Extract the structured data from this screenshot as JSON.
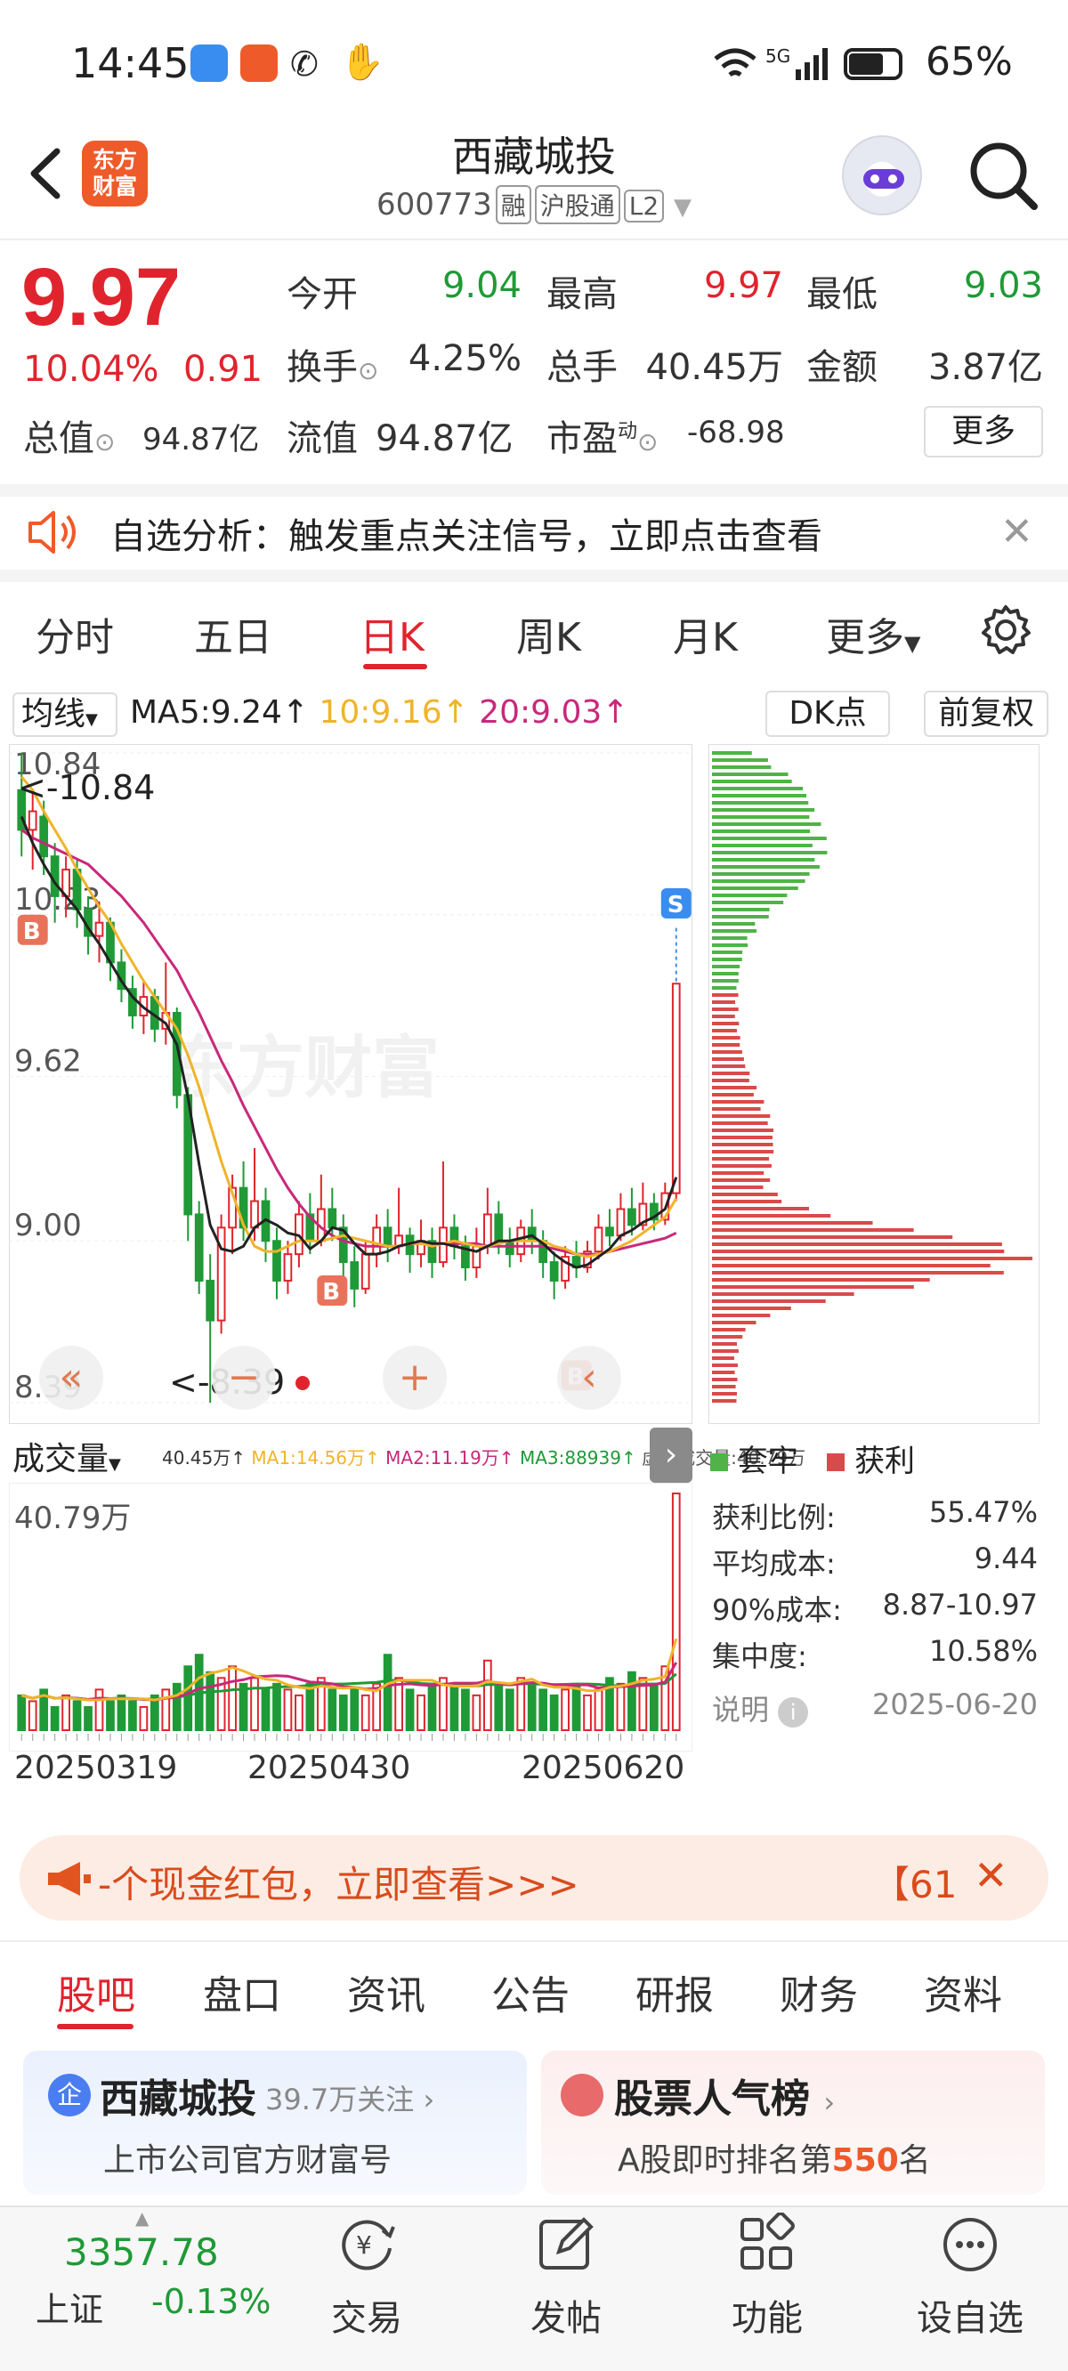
{
  "status": {
    "time": "14:45",
    "battery": "65%",
    "network": "5G"
  },
  "header": {
    "logo_text_1": "东方",
    "logo_text_2": "财富",
    "name": "西藏城投",
    "code": "600773",
    "tag_rong": "融",
    "tag_hk": "沪股通",
    "tag_level": "L2"
  },
  "quote": {
    "price": "9.97",
    "change_pct": "10.04%",
    "change_val": "0.91",
    "open_label": "今开",
    "open": "9.04",
    "high_label": "最高",
    "high": "9.97",
    "low_label": "最低",
    "low": "9.03",
    "turnover_label": "换手",
    "turnover": "4.25%",
    "volume_label": "总手",
    "volume": "40.45万",
    "amount_label": "金额",
    "amount": "3.87亿",
    "mktcap_label": "总值",
    "mktcap": "94.87亿",
    "float_label": "流值",
    "float": "94.87亿",
    "pe_label": "市盈",
    "pe_sup": "动",
    "pe": "-68.98",
    "more": "更多"
  },
  "notice": {
    "text": "自选分析：触发重点关注信号，立即点击查看"
  },
  "kline_tabs": [
    "分时",
    "五日",
    "日K",
    "周K",
    "月K",
    "更多"
  ],
  "kline_active": "日K",
  "ma_legend": {
    "selector": "均线",
    "ma5": "MA5:9.24↑",
    "ma10": "10:9.16↑",
    "ma20": "20:9.03↑",
    "dk": "DK点",
    "adjust": "前复权"
  },
  "colors": {
    "up": "#e0242e",
    "down": "#1f9a36",
    "ma5": "#222222",
    "ma10": "#f0b42a",
    "ma20": "#c9287a",
    "brand": "#ef5a2a"
  },
  "chart_data": [
    {
      "type": "candlestick",
      "yticks": [
        "10.84",
        "10.23",
        "9.62",
        "9.00",
        "8.39"
      ],
      "ylim": [
        8.39,
        10.84
      ],
      "high_marker": "<-10.84",
      "low_marker": "<-8.39",
      "marks": [
        "B",
        "B",
        "B",
        "S"
      ],
      "candles": [
        [
          10.7,
          10.55,
          10.84,
          10.45
        ],
        [
          10.55,
          10.62,
          10.7,
          10.4
        ],
        [
          10.6,
          10.45,
          10.66,
          10.38
        ],
        [
          10.45,
          10.3,
          10.5,
          10.2
        ],
        [
          10.3,
          10.4,
          10.45,
          10.22
        ],
        [
          10.4,
          10.25,
          10.44,
          10.18
        ],
        [
          10.25,
          10.15,
          10.3,
          10.08
        ],
        [
          10.15,
          10.2,
          10.28,
          10.05
        ],
        [
          10.2,
          10.05,
          10.22,
          9.98
        ],
        [
          10.05,
          9.95,
          10.1,
          9.9
        ],
        [
          9.95,
          9.85,
          10.0,
          9.8
        ],
        [
          9.85,
          9.92,
          9.98,
          9.78
        ],
        [
          9.92,
          9.8,
          9.95,
          9.75
        ],
        [
          9.8,
          9.86,
          10.05,
          9.74
        ],
        [
          9.86,
          9.55,
          9.88,
          9.5
        ],
        [
          9.55,
          9.1,
          9.58,
          9.0
        ],
        [
          9.1,
          8.85,
          9.15,
          8.8
        ],
        [
          8.85,
          8.7,
          8.95,
          8.39
        ],
        [
          8.7,
          9.05,
          9.1,
          8.65
        ],
        [
          9.05,
          9.2,
          9.25,
          8.95
        ],
        [
          9.2,
          9.05,
          9.3,
          9.0
        ],
        [
          9.05,
          9.15,
          9.35,
          9.0
        ],
        [
          9.15,
          9.0,
          9.2,
          8.92
        ],
        [
          9.0,
          8.85,
          9.05,
          8.78
        ],
        [
          8.85,
          8.95,
          9.0,
          8.8
        ],
        [
          8.95,
          9.1,
          9.15,
          8.9
        ],
        [
          9.1,
          9.0,
          9.18,
          8.95
        ],
        [
          9.0,
          9.12,
          9.25,
          8.98
        ],
        [
          9.12,
          9.05,
          9.2,
          9.0
        ],
        [
          9.05,
          8.92,
          9.1,
          8.85
        ],
        [
          8.92,
          8.82,
          8.98,
          8.75
        ],
        [
          8.82,
          8.95,
          9.0,
          8.8
        ],
        [
          8.95,
          9.05,
          9.1,
          8.9
        ],
        [
          9.05,
          8.98,
          9.12,
          8.92
        ],
        [
          8.98,
          9.02,
          9.2,
          8.95
        ],
        [
          9.02,
          8.95,
          9.05,
          8.88
        ],
        [
          8.95,
          9.0,
          9.08,
          8.9
        ],
        [
          9.0,
          8.92,
          9.05,
          8.86
        ],
        [
          8.92,
          9.05,
          9.3,
          8.9
        ],
        [
          9.05,
          8.98,
          9.1,
          8.93
        ],
        [
          8.98,
          8.9,
          9.02,
          8.85
        ],
        [
          8.9,
          8.98,
          9.05,
          8.86
        ],
        [
          8.98,
          9.1,
          9.2,
          8.95
        ],
        [
          9.1,
          9.0,
          9.15,
          8.95
        ],
        [
          9.0,
          8.95,
          9.05,
          8.9
        ],
        [
          8.95,
          9.05,
          9.08,
          8.92
        ],
        [
          9.05,
          9.0,
          9.12,
          8.95
        ],
        [
          9.0,
          8.92,
          9.04,
          8.86
        ],
        [
          8.92,
          8.85,
          8.96,
          8.78
        ],
        [
          8.85,
          8.94,
          8.98,
          8.82
        ],
        [
          8.94,
          8.9,
          9.0,
          8.86
        ],
        [
          8.9,
          8.96,
          9.0,
          8.88
        ],
        [
          8.96,
          9.05,
          9.1,
          8.93
        ],
        [
          9.05,
          9.02,
          9.12,
          8.98
        ],
        [
          9.02,
          9.12,
          9.18,
          9.0
        ],
        [
          9.12,
          9.06,
          9.2,
          9.02
        ],
        [
          9.06,
          9.14,
          9.22,
          9.04
        ],
        [
          9.14,
          9.08,
          9.18,
          9.04
        ],
        [
          9.08,
          9.18,
          9.22,
          9.06
        ],
        [
          9.18,
          9.97,
          9.97,
          9.15
        ]
      ],
      "ma5": [
        10.6,
        10.5,
        10.42,
        10.35,
        10.3,
        10.25,
        10.18,
        10.12,
        10.05,
        9.98,
        9.92,
        9.88,
        9.85,
        9.82,
        9.74,
        9.54,
        9.29,
        9.06,
        8.97,
        8.96,
        8.98,
        9.05,
        9.08,
        9.06,
        9.03,
        9.02,
        8.97,
        9.0,
        9.05,
        9.04,
        8.99,
        8.95,
        8.95,
        8.96,
        8.98,
        8.99,
        9.0,
        8.99,
        8.99,
        8.98,
        8.97,
        8.96,
        8.98,
        9.0,
        9.0,
        9.01,
        9.02,
        8.99,
        8.95,
        8.92,
        8.9,
        8.91,
        8.94,
        8.97,
        9.02,
        9.04,
        9.07,
        9.09,
        9.12,
        9.24
      ],
      "ma10": [
        10.75,
        10.7,
        10.62,
        10.55,
        10.48,
        10.4,
        10.33,
        10.26,
        10.2,
        10.12,
        10.05,
        9.98,
        9.92,
        9.86,
        9.8,
        9.7,
        9.58,
        9.44,
        9.3,
        9.18,
        9.06,
        8.98,
        8.96,
        8.96,
        8.98,
        9.0,
        9.0,
        9.0,
        9.01,
        9.02,
        9.01,
        9.0,
        8.99,
        8.98,
        8.98,
        8.99,
        8.99,
        8.98,
        8.99,
        9.0,
        8.99,
        8.98,
        8.98,
        8.99,
        9.0,
        9.0,
        9.0,
        9.0,
        8.98,
        8.97,
        8.95,
        8.94,
        8.95,
        8.96,
        8.98,
        9.0,
        9.03,
        9.06,
        9.09,
        9.16
      ],
      "ma20": [
        10.55,
        10.52,
        10.5,
        10.48,
        10.46,
        10.44,
        10.42,
        10.38,
        10.34,
        10.3,
        10.25,
        10.2,
        10.14,
        10.08,
        10.02,
        9.94,
        9.86,
        9.77,
        9.68,
        9.6,
        9.51,
        9.43,
        9.35,
        9.27,
        9.2,
        9.14,
        9.09,
        9.05,
        9.02,
        9.0,
        8.99,
        8.98,
        8.98,
        8.98,
        8.98,
        8.99,
        8.99,
        8.99,
        8.99,
        8.99,
        8.99,
        8.99,
        8.98,
        8.98,
        8.98,
        8.98,
        8.98,
        8.98,
        8.97,
        8.96,
        8.95,
        8.95,
        8.95,
        8.96,
        8.97,
        8.98,
        8.99,
        9.0,
        9.01,
        9.03
      ]
    },
    {
      "type": "bar",
      "title": "成交量",
      "legend": {
        "vol": "40.45万↑",
        "ma1": "MA1:14.56万↑",
        "ma2": "MA2:11.19万↑",
        "ma3": "MA3:88939↑",
        "virtual": "虚拟成交量:40.79万"
      },
      "max_label": "40.79万",
      "x_ticks": [
        "20250319",
        "20250430",
        "20250620"
      ],
      "values": [
        6,
        5,
        7,
        4,
        6,
        5,
        4,
        7,
        5,
        6,
        5,
        4,
        6,
        7,
        8,
        11,
        13,
        10,
        9,
        11,
        8,
        9,
        7,
        8,
        7,
        6,
        8,
        9,
        7,
        6,
        7,
        6,
        8,
        13,
        9,
        7,
        6,
        8,
        9,
        8,
        7,
        6,
        12,
        8,
        7,
        9,
        8,
        7,
        6,
        7,
        8,
        6,
        7,
        9,
        8,
        10,
        9,
        8,
        11,
        40.79
      ]
    },
    {
      "type": "bar",
      "title": "筹码分布",
      "legend": [
        "套牢",
        "获利"
      ],
      "profit_ratio_label": "获利比例:",
      "profit_ratio": "55.47%",
      "avg_cost_label": "平均成本:",
      "avg_cost": "9.44",
      "cost90_label": "90%成本:",
      "cost90": "8.87-10.97",
      "concentration_label": "集中度:",
      "concentration": "10.58%",
      "note": "说明",
      "date": "2025-06-20"
    }
  ],
  "promo": {
    "text": "-个现金红包，立即查看>>>",
    "tag": "【61",
    "close": "✕"
  },
  "bottom_tabs": [
    "股吧",
    "盘口",
    "资讯",
    "公告",
    "研报",
    "财务",
    "资料"
  ],
  "cards": {
    "card1_title": "西藏城投",
    "card1_follow": "39.7万关注",
    "card1_sub": "上市公司官方财富号",
    "card2_title": "股票人气榜",
    "card2_sub_prefix": "A股即时排名第",
    "card2_rank": "550",
    "card2_sub_suffix": "名"
  },
  "index": {
    "value": "3357.78",
    "name": "上证",
    "change": "-0.13%"
  },
  "bottom_nav": [
    "交易",
    "发帖",
    "功能",
    "设自选"
  ]
}
